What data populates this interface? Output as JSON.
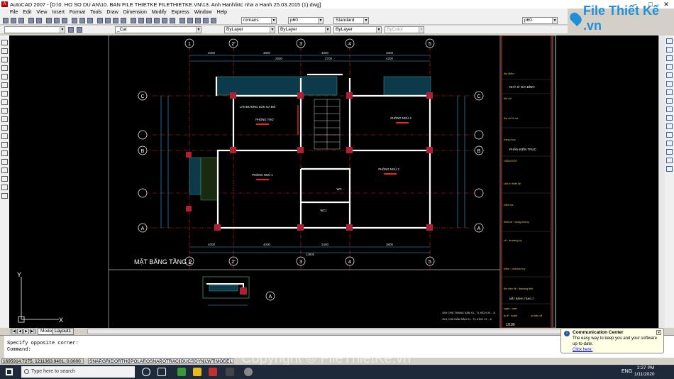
{
  "window": {
    "title": "AutoCAD 2007 - [D:\\0. HO SO DU AN\\10. BAN FILE THIETKE FILETHIETKE.VN\\13. Anh Hanh\\ktc nha a Hanh 25.03.2015 (1).dwg]",
    "app_icon": "A"
  },
  "menu": [
    "File",
    "Edit",
    "View",
    "Insert",
    "Format",
    "Tools",
    "Draw",
    "Dimension",
    "Modify",
    "Express",
    "Window",
    "Help"
  ],
  "toolbar": {
    "text_style": "romans",
    "dim_style": "p60",
    "table_style": "Standard",
    "layer": "_Cat",
    "color": "ByLayer",
    "linetype": "ByLayer",
    "lineweight": "ByLayer",
    "plotstyle": "ByColor",
    "view": "p60"
  },
  "logo": {
    "text": "File Thiết Kế .vn"
  },
  "drawing": {
    "plan_title": "MẶT BẰNG TẦNG 2",
    "axes_top": [
      "1",
      "2'",
      "3",
      "4",
      "5"
    ],
    "axes_side": [
      "C",
      "B",
      "A"
    ],
    "rooms": [
      "LAN ĐƯƠNG SON GẠ ĐỎ",
      "PHÒNG THỜ",
      "PHÒNG NGỦ 3",
      "PHÒNG NGỦ 1",
      "PHÒNG NGỦ 2",
      "WC",
      "WC1"
    ],
    "dims_top": [
      "2000",
      "3800",
      "4000",
      "4000",
      "2500",
      "2700",
      "4200"
    ],
    "dims_bottom": [
      "4000",
      "4000",
      "2400",
      "3800",
      "13800"
    ],
    "scale": "1/100",
    "section_label": "A",
    "titleblock": [
      "địa điểm : ",
      "NHÀ Ở GIA ĐÌNH",
      "địa chỉ",
      "địa chỉ lô số : ",
      "hạng mục",
      "PHẦN KIẾN TRÚC",
      "GIÁM ĐỐC",
      "chủ trì thiết kế",
      "kiểm tra",
      "thiết kế : designed by",
      "vẽ : drawing by",
      "kiểm : checked by",
      "tên bản vẽ : drawing title",
      "MẶT BẰNG TẦNG 2",
      "ngày : date",
      "tỷ lệ : scale",
      "số bản vẽ"
    ],
    "notes": [
      "- GHI CHÚ THANG SÀN X1 - TL KÍCH X1 - 1/",
      "- GHI CHÚ DẦM SÀN X1 - TL KÍCH X1 - 1/"
    ],
    "ucs": {
      "x": "X",
      "y": "Y"
    }
  },
  "tabs": {
    "model": "Model",
    "layout": "Layout1"
  },
  "command": {
    "line1": "Specify opposite corner:",
    "line2": "Command:"
  },
  "status": {
    "coords": "1695914.7275, 1211363.9401, 0.0000",
    "toggles": [
      "SNAP",
      "GRID",
      "ORTHO",
      "POLAR",
      "OSNAP",
      "OTRACK",
      "DUCS",
      "DYN",
      "LWT",
      "MODEL"
    ]
  },
  "notification": {
    "title": "Communication Center",
    "body": "The easy way to keep you and your software up-to-date.",
    "link": "Click here."
  },
  "taskbar": {
    "search": "Type here to search",
    "lang": "ENG",
    "time": "2:27 PM",
    "date": "1/11/2020"
  },
  "watermark": "Copyright © FileThietKe.vn"
}
